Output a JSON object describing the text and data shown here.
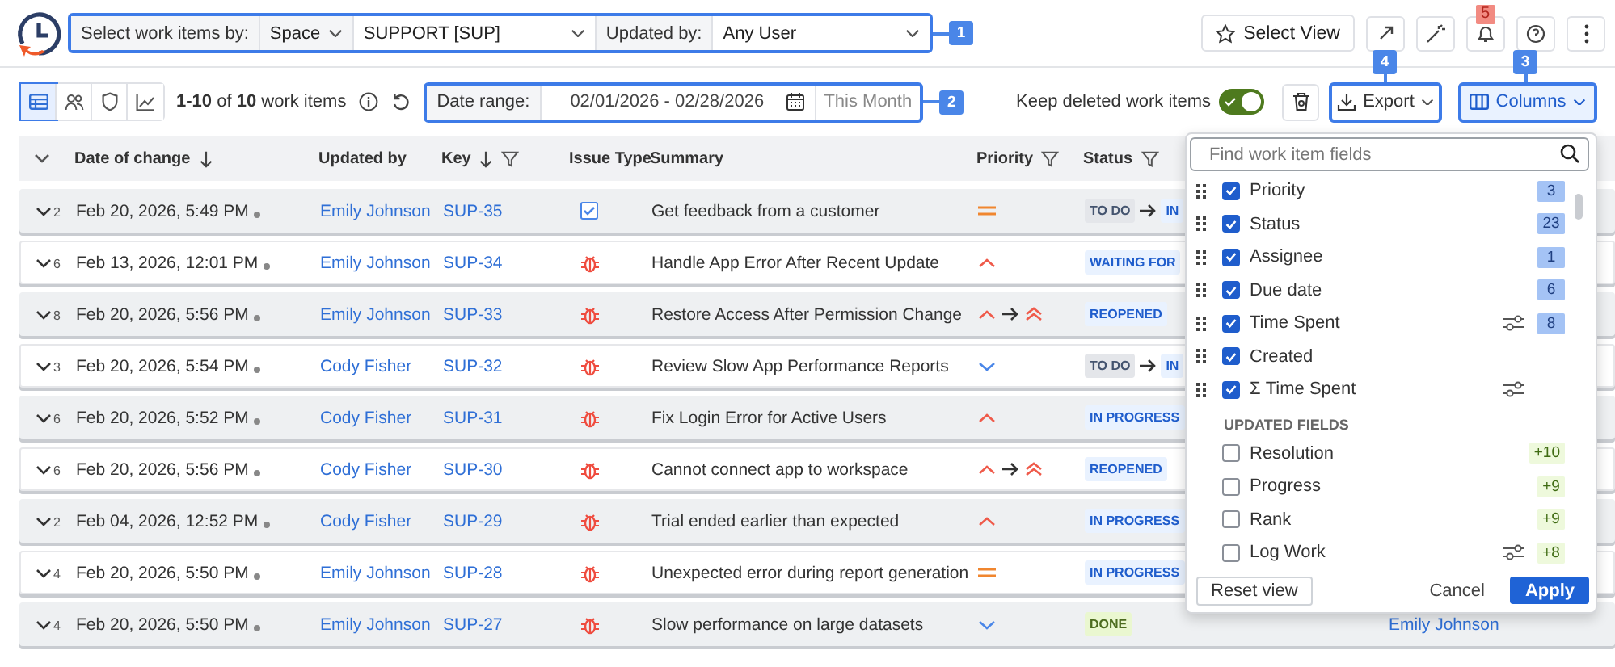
{
  "header": {
    "select_label": "Select work items by:",
    "mode": "Space",
    "project": "SUPPORT [SUP]",
    "updated_by_label": "Updated by:",
    "updated_by": "Any User",
    "select_view": "Select View",
    "notification_count": "5"
  },
  "toolbar": {
    "views": [
      {
        "selected": true
      },
      {
        "selected": false
      },
      {
        "selected": false
      },
      {
        "selected": false
      }
    ],
    "count": "**1-10** of **10** work items",
    "date_label": "Date range:",
    "date_value": "02/01/2026 - 02/28/2026",
    "date_preset": "This Month",
    "keep_deleted_label": "Keep deleted work items",
    "keep_deleted_on": true,
    "export": "Export",
    "columns": "Columns"
  },
  "callouts": [
    "1",
    "2",
    "3",
    "4"
  ],
  "table": {
    "columns": [
      "Date of change",
      "Updated by",
      "Key",
      "Issue Type",
      "Summary",
      "Priority",
      "Status"
    ],
    "rows": [
      {
        "changes": "2",
        "date": "Feb 20, 2026, 5:49 PM",
        "user": "Emily Johnson",
        "key": "SUP-35",
        "issue": {
          "kind": "task"
        },
        "summary": "Get feedback from a customer",
        "priority": [
          {
            "kind": "medium"
          }
        ],
        "status": [
          {
            "kind": "todo",
            "text": "TO DO"
          },
          {
            "kind": "arrow"
          },
          {
            "kind": "progress",
            "text": "IN"
          }
        ]
      },
      {
        "changes": "6",
        "date": "Feb 13, 2026, 12:01 PM",
        "user": "Emily Johnson",
        "key": "SUP-34",
        "issue": {
          "kind": "bug"
        },
        "summary": "Handle App Error After Recent Update",
        "priority": [
          {
            "kind": "high"
          }
        ],
        "status": [
          {
            "kind": "progress",
            "text": "WAITING FOR"
          }
        ]
      },
      {
        "changes": "8",
        "date": "Feb 20, 2026, 5:56 PM",
        "user": "Emily Johnson",
        "key": "SUP-33",
        "issue": {
          "kind": "bug"
        },
        "summary": "Restore Access After Permission Change",
        "priority": [
          {
            "kind": "high"
          },
          {
            "kind": "arrow"
          },
          {
            "kind": "highest"
          }
        ],
        "status": [
          {
            "kind": "progress",
            "text": "REOPENED"
          }
        ]
      },
      {
        "changes": "3",
        "date": "Feb 20, 2026, 5:54 PM",
        "user": "Cody Fisher",
        "key": "SUP-32",
        "issue": {
          "kind": "bug"
        },
        "summary": "Review Slow App Performance Reports",
        "priority": [
          {
            "kind": "low"
          }
        ],
        "status": [
          {
            "kind": "todo",
            "text": "TO DO"
          },
          {
            "kind": "arrow"
          },
          {
            "kind": "progress",
            "text": "IN"
          }
        ]
      },
      {
        "changes": "6",
        "date": "Feb 20, 2026, 5:52 PM",
        "user": "Cody Fisher",
        "key": "SUP-31",
        "issue": {
          "kind": "bug"
        },
        "summary": "Fix Login Error for Active Users",
        "priority": [
          {
            "kind": "high"
          }
        ],
        "status": [
          {
            "kind": "progress",
            "text": "IN PROGRESS"
          }
        ]
      },
      {
        "changes": "6",
        "date": "Feb 20, 2026, 5:56 PM",
        "user": "Cody Fisher",
        "key": "SUP-30",
        "issue": {
          "kind": "bug"
        },
        "summary": "Cannot connect app to workspace",
        "priority": [
          {
            "kind": "high"
          },
          {
            "kind": "arrow"
          },
          {
            "kind": "highest"
          }
        ],
        "status": [
          {
            "kind": "progress",
            "text": "REOPENED"
          }
        ]
      },
      {
        "changes": "2",
        "date": "Feb 04, 2026, 12:52 PM",
        "user": "Cody Fisher",
        "key": "SUP-29",
        "issue": {
          "kind": "bug"
        },
        "summary": "Trial ended earlier than expected",
        "priority": [
          {
            "kind": "high"
          }
        ],
        "status": [
          {
            "kind": "progress",
            "text": "IN PROGRESS"
          }
        ]
      },
      {
        "changes": "4",
        "date": "Feb 20, 2026, 5:50 PM",
        "user": "Emily Johnson",
        "key": "SUP-28",
        "issue": {
          "kind": "bug"
        },
        "summary": "Unexpected error during report generation",
        "priority": [
          {
            "kind": "medium"
          }
        ],
        "status": [
          {
            "kind": "progress",
            "text": "IN PROGRESS"
          }
        ]
      },
      {
        "changes": "4",
        "date": "Feb 20, 2026, 5:50 PM",
        "user": "Emily Johnson",
        "key": "SUP-27",
        "issue": {
          "kind": "bug"
        },
        "summary": "Slow performance on large datasets",
        "priority": [
          {
            "kind": "low"
          }
        ],
        "status": [
          {
            "kind": "done",
            "text": "DONE"
          }
        ],
        "assignee": "Emily Johnson"
      }
    ]
  },
  "column_picker": {
    "search_placeholder": "Find work item fields",
    "selected_fields": [
      {
        "label": "Priority",
        "checked": true,
        "count": "3"
      },
      {
        "label": "Status",
        "checked": true,
        "count": "23"
      },
      {
        "label": "Assignee",
        "checked": true,
        "count": "1"
      },
      {
        "label": "Due date",
        "checked": true,
        "count": "6"
      },
      {
        "label": "Time Spent",
        "checked": true,
        "settings": true,
        "count": "8"
      },
      {
        "label": "Created",
        "checked": true
      },
      {
        "label": "Σ Time Spent",
        "checked": true,
        "settings": true
      }
    ],
    "updated_title": "UPDATED FIELDS",
    "updated_fields": [
      {
        "label": "Resolution",
        "checked": false,
        "count": "+10"
      },
      {
        "label": "Progress",
        "checked": false,
        "count": "+9"
      },
      {
        "label": "Rank",
        "checked": false,
        "count": "+9"
      },
      {
        "label": "Log Work",
        "checked": false,
        "settings": true,
        "count": "+8"
      }
    ],
    "reset": "Reset view",
    "cancel": "Cancel",
    "apply": "Apply"
  }
}
